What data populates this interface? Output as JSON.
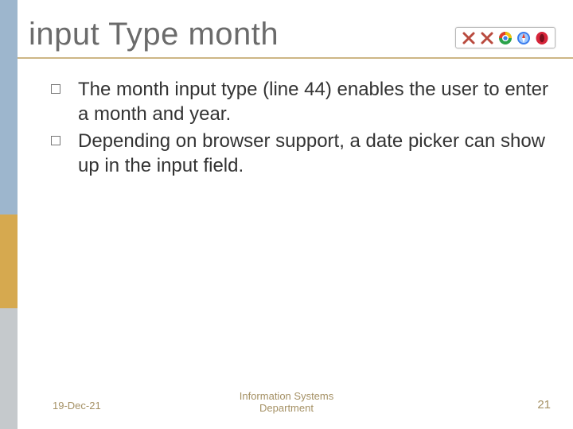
{
  "title": "input Type month",
  "bullets": [
    "The month input type (line 44) enables the user to enter a month and year.",
    "Depending on browser support, a date picker can show up in the input field."
  ],
  "browser_icons": [
    "ie-icon",
    "firefox-icon",
    "chrome-icon",
    "safari-icon",
    "opera-icon"
  ],
  "footer": {
    "date": "19-Dec-21",
    "center": "Information Systems\nDepartment",
    "slide_number": "21"
  },
  "colors": {
    "sidebar_top": "#9db6cd",
    "sidebar_mid": "#d6a94f",
    "sidebar_bot": "#c5c9cc",
    "rule": "#cdb685",
    "title": "#6b6b6b",
    "footer": "#a59165"
  }
}
